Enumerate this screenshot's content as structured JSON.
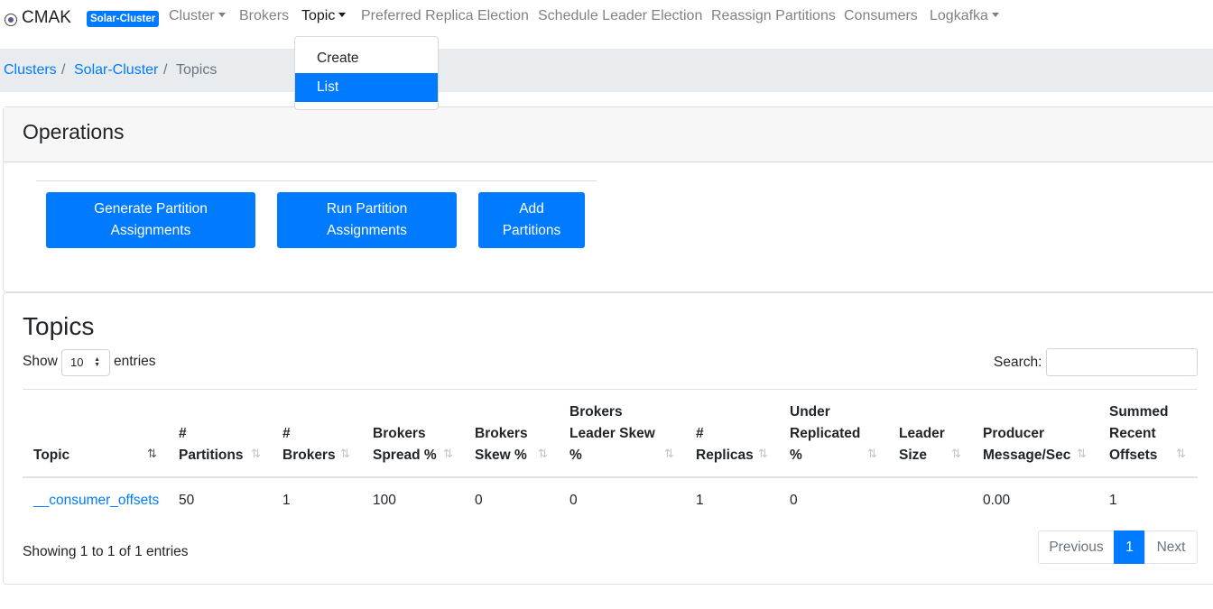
{
  "navbar": {
    "brand": "CMAK",
    "cluster_badge": "Solar-Cluster",
    "items": [
      {
        "label": "Cluster"
      },
      {
        "label": "Brokers"
      },
      {
        "label": "Topic"
      },
      {
        "label": "Preferred Replica Election"
      },
      {
        "label": "Schedule Leader Election"
      },
      {
        "label": "Reassign Partitions"
      },
      {
        "label": "Consumers"
      },
      {
        "label": "Logkafka"
      }
    ],
    "topic_menu": [
      {
        "label": "Create"
      },
      {
        "label": "List"
      }
    ]
  },
  "breadcrumb": {
    "items": [
      "Clusters",
      "Solar-Cluster",
      "Topics"
    ],
    "separator": "/"
  },
  "operations": {
    "title": "Operations",
    "buttons": [
      {
        "line1": "Generate Partition",
        "line2": "Assignments"
      },
      {
        "line1": "Run Partition",
        "line2": "Assignments"
      },
      {
        "line1": "Add",
        "line2": "Partitions"
      }
    ]
  },
  "topics": {
    "title": "Topics",
    "show_label": "Show",
    "length_value": "10",
    "entries_label": "entries",
    "search_label": "Search:",
    "search_value": "",
    "columns": [
      {
        "lines": [
          "Topic"
        ]
      },
      {
        "lines": [
          "#",
          "Partitions"
        ]
      },
      {
        "lines": [
          "#",
          "Brokers"
        ]
      },
      {
        "lines": [
          "Brokers",
          "Spread %"
        ]
      },
      {
        "lines": [
          "Brokers",
          "Skew %"
        ]
      },
      {
        "lines": [
          "Brokers",
          "Leader Skew",
          "%"
        ]
      },
      {
        "lines": [
          "#",
          "Replicas"
        ]
      },
      {
        "lines": [
          "Under",
          "Replicated",
          "%"
        ]
      },
      {
        "lines": [
          "Leader",
          "Size"
        ]
      },
      {
        "lines": [
          "Producer",
          "Message/Sec"
        ]
      },
      {
        "lines": [
          "Summed",
          "Recent",
          "Offsets"
        ]
      }
    ],
    "sort_icon": "⇅",
    "rows": [
      [
        "__consumer_offsets",
        "50",
        "1",
        "100",
        "0",
        "0",
        "1",
        "0",
        "",
        "0.00",
        "1"
      ]
    ],
    "info": "Showing 1 to 1 of 1 entries",
    "pagination": {
      "previous": "Previous",
      "current": "1",
      "next": "Next"
    }
  },
  "colors": {
    "primary": "#007bff",
    "breadcrumb_bg": "#e9ecef",
    "card_header_bg": "#f7f7f7"
  }
}
